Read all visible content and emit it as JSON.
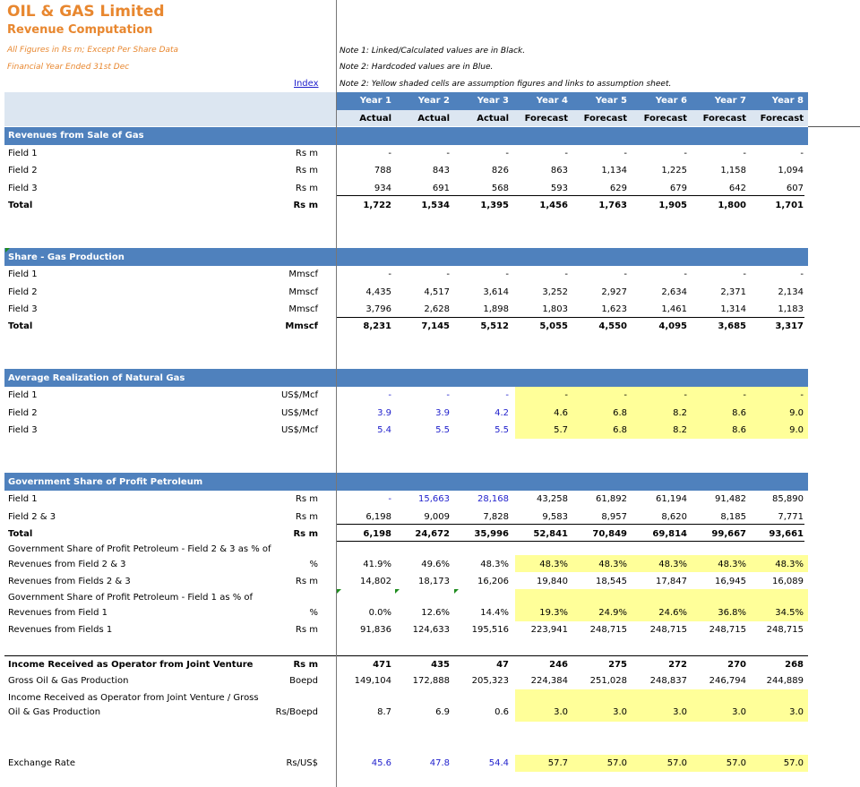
{
  "title": "OIL & GAS Limited",
  "subtitle": "Revenue Computation",
  "notes_left": [
    "All Figures in Rs m; Except Per Share Data",
    "Financial Year Ended 31st Dec"
  ],
  "notes_right": [
    "Note 1: Linked/Calculated values are in Black.",
    "Note 2: Hardcoded values are in Blue.",
    "Note 2: Yellow shaded cells are assumption figures and links to assumption sheet."
  ],
  "index_link": "Index",
  "colors": {
    "band": "#4F81BD",
    "band_light": "#DCE6F1",
    "assumption": "#FFFF99",
    "hardcoded": "#1F1FCC",
    "title": "#E8872F"
  },
  "years": [
    "Year 1",
    "Year 2",
    "Year 3",
    "Year 4",
    "Year 5",
    "Year 6",
    "Year 7",
    "Year 8"
  ],
  "types": [
    "Actual",
    "Actual",
    "Actual",
    "Forecast",
    "Forecast",
    "Forecast",
    "Forecast",
    "Forecast"
  ],
  "sections": {
    "s1": "Revenues from Sale of Gas",
    "s2": "Share - Gas Production",
    "s3": "Average Realization of Natural Gas",
    "s4": "Government Share of Profit Petroleum"
  },
  "rows": [
    {
      "label": "Field 1",
      "unit": "Rs m",
      "values": [
        "-",
        "-",
        "-",
        "-",
        "-",
        "-",
        "-",
        "-"
      ]
    },
    {
      "label": "Field 2",
      "unit": "Rs m",
      "values": [
        "788",
        "843",
        "826",
        "863",
        "1,134",
        "1,225",
        "1,158",
        "1,094"
      ]
    },
    {
      "label": "Field 3",
      "unit": "Rs m",
      "values": [
        "934",
        "691",
        "568",
        "593",
        "629",
        "679",
        "642",
        "607"
      ]
    },
    {
      "label": "Total",
      "unit": "Rs m",
      "values": [
        "1,722",
        "1,534",
        "1,395",
        "1,456",
        "1,763",
        "1,905",
        "1,800",
        "1,701"
      ]
    },
    {
      "label": "Field 1",
      "unit": "Mmscf",
      "values": [
        "-",
        "-",
        "-",
        "-",
        "-",
        "-",
        "-",
        "-"
      ]
    },
    {
      "label": "Field 2",
      "unit": "Mmscf",
      "values": [
        "4,435",
        "4,517",
        "3,614",
        "3,252",
        "2,927",
        "2,634",
        "2,371",
        "2,134"
      ]
    },
    {
      "label": "Field 3",
      "unit": "Mmscf",
      "values": [
        "3,796",
        "2,628",
        "1,898",
        "1,803",
        "1,623",
        "1,461",
        "1,314",
        "1,183"
      ]
    },
    {
      "label": "Total",
      "unit": "Mmscf",
      "values": [
        "8,231",
        "7,145",
        "5,512",
        "5,055",
        "4,550",
        "4,095",
        "3,685",
        "3,317"
      ]
    },
    {
      "label": "Field 1",
      "unit": "US$/Mcf",
      "values": [
        "-",
        "-",
        "-",
        "-",
        "-",
        "-",
        "-",
        "-"
      ]
    },
    {
      "label": "Field 2",
      "unit": "US$/Mcf",
      "values": [
        "3.9",
        "3.9",
        "4.2",
        "4.6",
        "6.8",
        "8.2",
        "8.6",
        "9.0"
      ]
    },
    {
      "label": "Field 3",
      "unit": "US$/Mcf",
      "values": [
        "5.4",
        "5.5",
        "5.5",
        "5.7",
        "6.8",
        "8.2",
        "8.6",
        "9.0"
      ]
    },
    {
      "label": "Field 1",
      "unit": "Rs m",
      "values": [
        "-",
        "15,663",
        "28,168",
        "43,258",
        "61,892",
        "61,194",
        "91,482",
        "85,890"
      ]
    },
    {
      "label": "Field 2 & 3",
      "unit": "Rs m",
      "values": [
        "6,198",
        "9,009",
        "7,828",
        "9,583",
        "8,957",
        "8,620",
        "8,185",
        "7,771"
      ]
    },
    {
      "label": "Total",
      "unit": "Rs m",
      "values": [
        "6,198",
        "24,672",
        "35,996",
        "52,841",
        "70,849",
        "69,814",
        "99,667",
        "93,661"
      ]
    },
    {
      "label": "Government Share of Profit Petroleum - Field 2 & 3 as % of",
      "unit": "",
      "values": [
        "",
        "",
        "",
        "",
        "",
        "",
        "",
        ""
      ]
    },
    {
      "label": "Revenues from Field 2 & 3",
      "unit": "%",
      "values": [
        "41.9%",
        "49.6%",
        "48.3%",
        "48.3%",
        "48.3%",
        "48.3%",
        "48.3%",
        "48.3%"
      ]
    },
    {
      "label": "Revenues from Fields 2 & 3",
      "unit": "Rs m",
      "values": [
        "14,802",
        "18,173",
        "16,206",
        "19,840",
        "18,545",
        "17,847",
        "16,945",
        "16,089"
      ]
    },
    {
      "label": "Government Share of Profit Petroleum - Field 1 as % of",
      "unit": "",
      "values": [
        "",
        "",
        "",
        "",
        "",
        "",
        "",
        ""
      ]
    },
    {
      "label": "Revenues from Field 1",
      "unit": "%",
      "values": [
        "0.0%",
        "12.6%",
        "14.4%",
        "19.3%",
        "24.9%",
        "24.6%",
        "36.8%",
        "34.5%"
      ]
    },
    {
      "label": "Revenues from Fields 1",
      "unit": "Rs m",
      "values": [
        "91,836",
        "124,633",
        "195,516",
        "223,941",
        "248,715",
        "248,715",
        "248,715",
        "248,715"
      ]
    },
    {
      "label": "Income Received as Operator from Joint Venture",
      "unit": "Rs m",
      "values": [
        "471",
        "435",
        "47",
        "246",
        "275",
        "272",
        "270",
        "268"
      ]
    },
    {
      "label": "Gross Oil & Gas Production",
      "unit": "Boepd",
      "values": [
        "149,104",
        "172,888",
        "205,323",
        "224,384",
        "251,028",
        "248,837",
        "246,794",
        "244,889"
      ]
    },
    {
      "label": "Income Received as Operator from Joint Venture / Gross",
      "unit": "",
      "values": [
        "",
        "",
        "",
        "",
        "",
        "",
        "",
        ""
      ]
    },
    {
      "label": "Oil & Gas Production",
      "unit": "Rs/Boepd",
      "values": [
        "8.7",
        "6.9",
        "0.6",
        "3.0",
        "3.0",
        "3.0",
        "3.0",
        "3.0"
      ]
    },
    {
      "label": "Exchange Rate",
      "unit": "Rs/US$",
      "values": [
        "45.6",
        "47.8",
        "54.4",
        "57.7",
        "57.0",
        "57.0",
        "57.0",
        "57.0"
      ]
    }
  ]
}
